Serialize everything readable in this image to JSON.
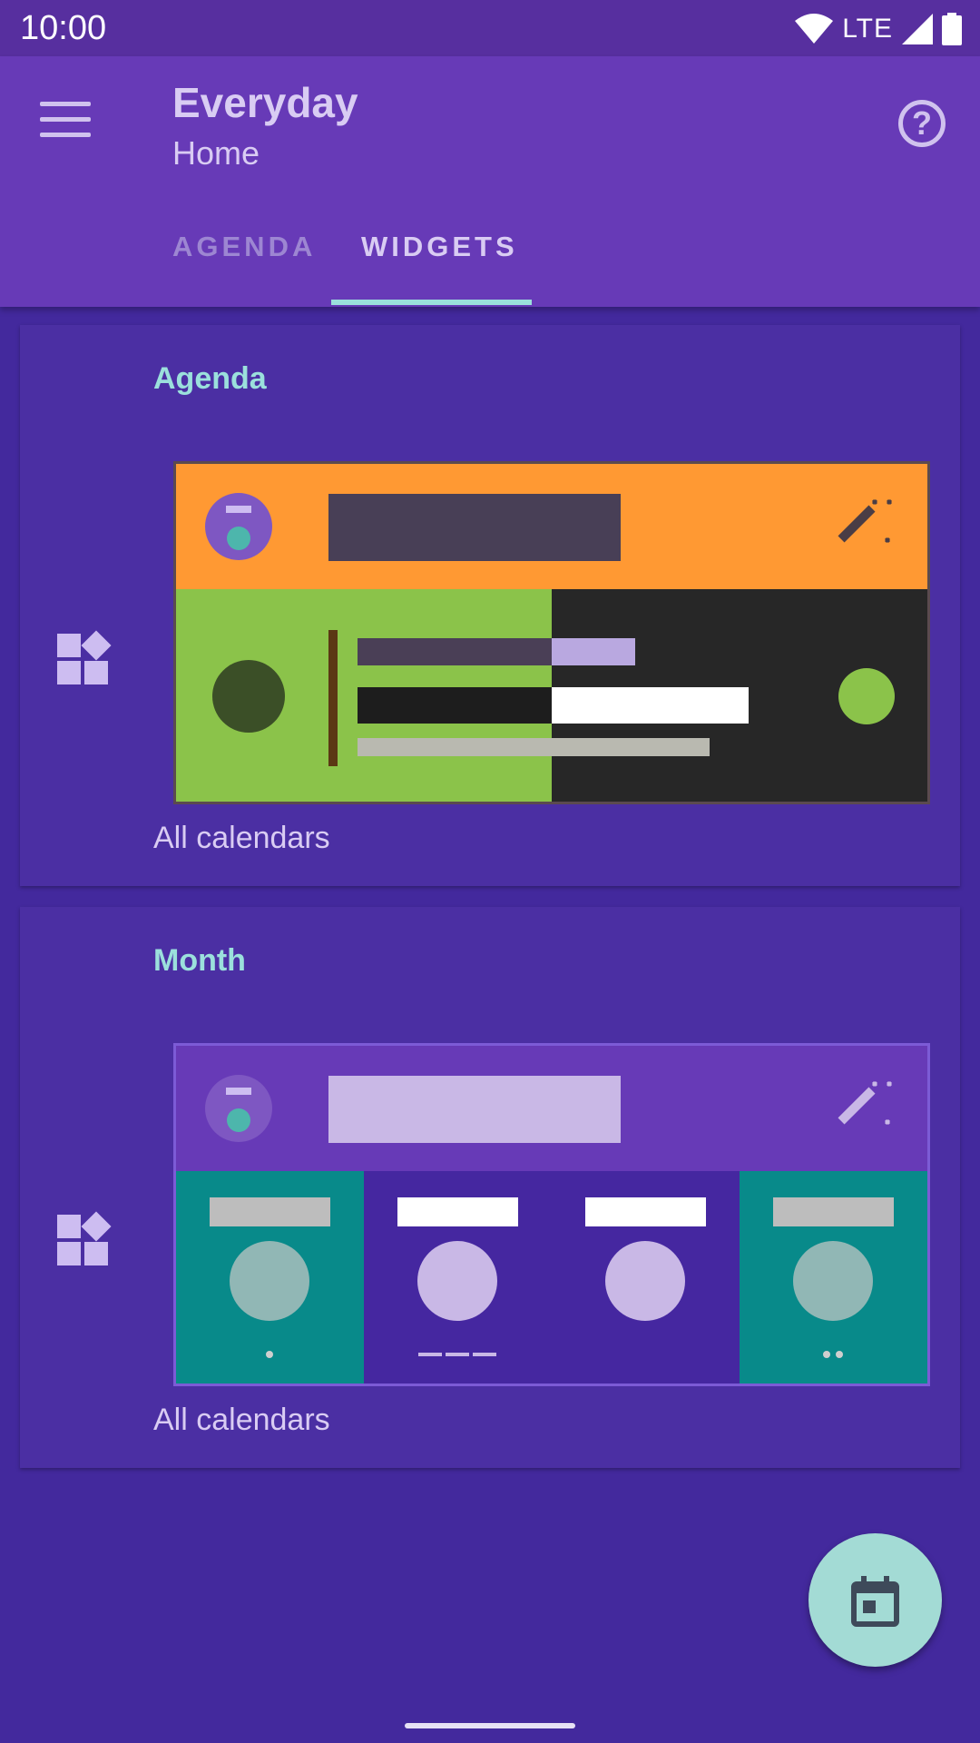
{
  "status_bar": {
    "time": "10:00",
    "network": "LTE"
  },
  "app_bar": {
    "title": "Everyday",
    "subtitle": "Home"
  },
  "tabs": [
    {
      "label": "AGENDA",
      "selected": false
    },
    {
      "label": "WIDGETS",
      "selected": true
    }
  ],
  "widgets": [
    {
      "title": "Agenda",
      "calendars": "All calendars"
    },
    {
      "title": "Month",
      "calendars": "All calendars"
    }
  ],
  "colors": {
    "primary": "#673ab7",
    "background": "#43299d",
    "accent": "#9be0dc",
    "fab": "#a3dbd5",
    "agenda_header": "#ff9933",
    "agenda_green": "#8bc34a",
    "month_teal": "#088a8a"
  },
  "icons": {
    "menu": "menu-icon",
    "help": "help-icon",
    "widget": "widgets-icon",
    "magic": "magic-wand-icon",
    "fab": "calendar-icon"
  }
}
